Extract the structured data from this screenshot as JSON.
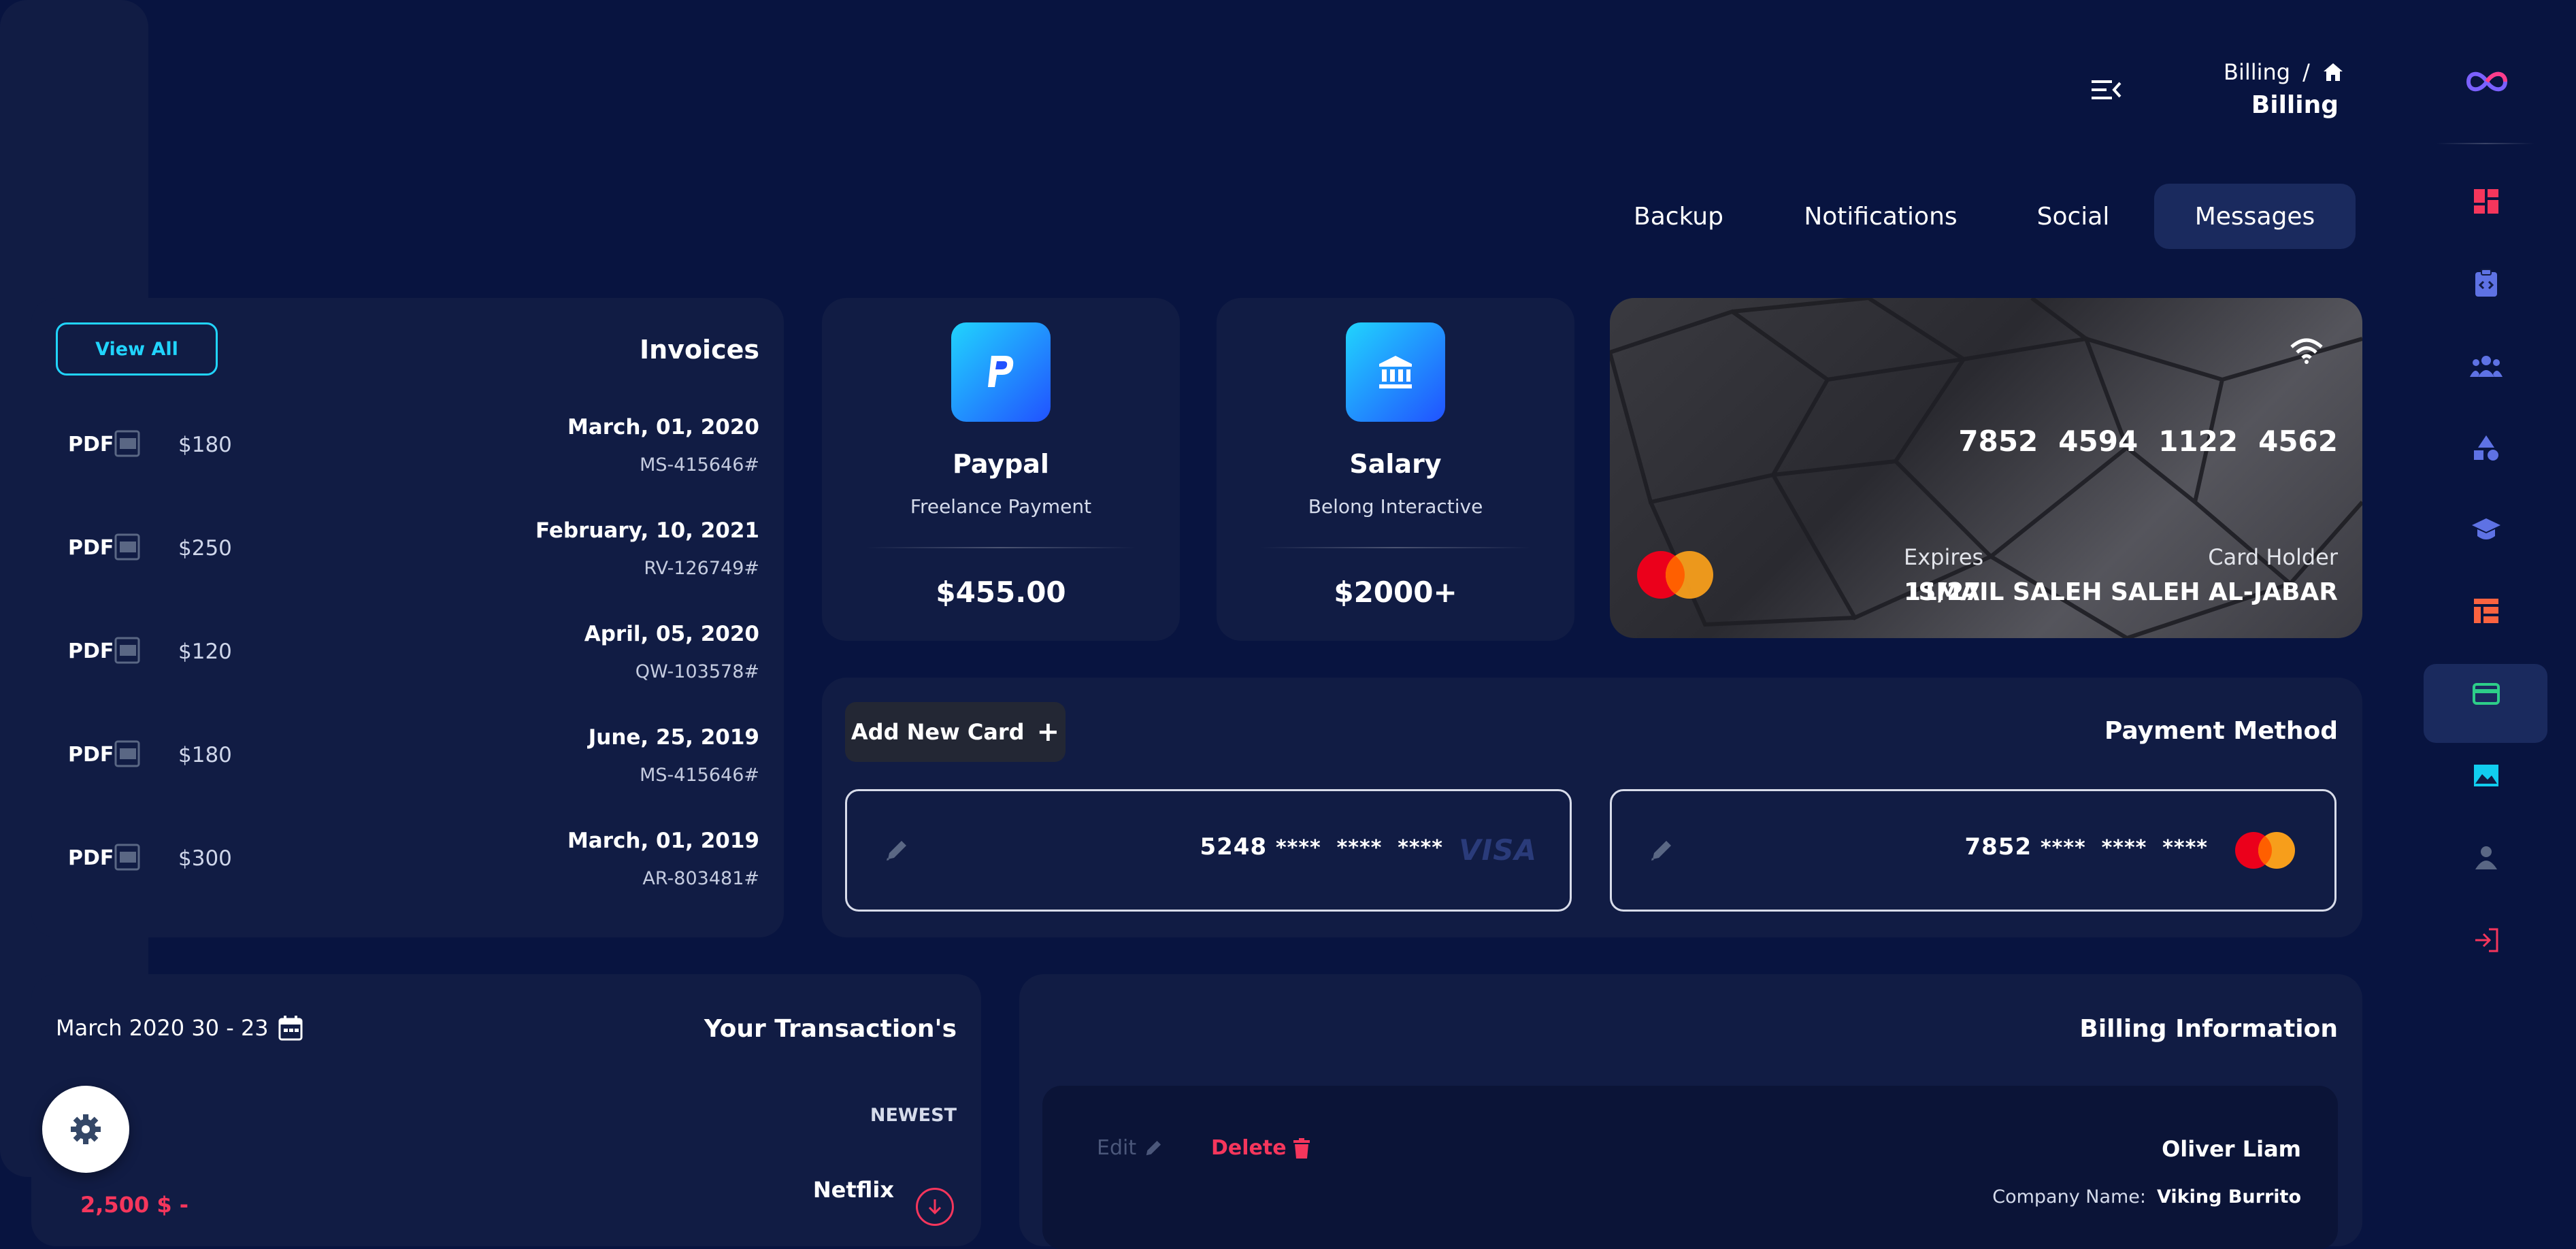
{
  "header": {
    "breadcrumb_current": "Billing",
    "breadcrumb_separator": "/",
    "page_title": "Billing"
  },
  "tabs": [
    {
      "label": "Backup"
    },
    {
      "label": "Notifications"
    },
    {
      "label": "Social"
    },
    {
      "label": "Messages",
      "active": true
    }
  ],
  "invoices": {
    "title": "Invoices",
    "view_all_label": "View All",
    "items": [
      {
        "pdf": "PDF",
        "amount": "$180",
        "date": "March, 01, 2020",
        "code": "MS-415646#"
      },
      {
        "pdf": "PDF",
        "amount": "$250",
        "date": "February, 10, 2021",
        "code": "RV-126749#"
      },
      {
        "pdf": "PDF",
        "amount": "$120",
        "date": "April, 05, 2020",
        "code": "QW-103578#"
      },
      {
        "pdf": "PDF",
        "amount": "$180",
        "date": "June, 25, 2019",
        "code": "MS-415646#"
      },
      {
        "pdf": "PDF",
        "amount": "$300",
        "date": "March, 01, 2019",
        "code": "AR-803481#"
      }
    ]
  },
  "paypal": {
    "title": "Paypal",
    "subtitle": "Freelance Payment",
    "value": "$455.00",
    "icon": "paypal-icon"
  },
  "salary": {
    "title": "Salary",
    "subtitle": "Belong Interactive",
    "value": "$2000+",
    "icon": "bank-icon"
  },
  "credit_card": {
    "number_groups": [
      "7852",
      "4594",
      "1122",
      "4562"
    ],
    "expires_label": "Expires",
    "expires_value": "11/27",
    "holder_label": "Card Holder",
    "holder_value": "ISMAIL SALEH SALEH AL-JABAR"
  },
  "payment_method": {
    "title": "Payment Method",
    "add_card_label": "Add New Card",
    "add_card_icon": "+",
    "cards": [
      {
        "first": "5248",
        "masked": "****  ****  ****",
        "brand": "VISA"
      },
      {
        "first": "7852",
        "masked": "****  ****  ****",
        "brand": "mastercard"
      }
    ]
  },
  "transactions": {
    "title": "Your Transaction's",
    "date_range": "March 2020 30 - 23",
    "sort_label": "NEWEST",
    "items": [
      {
        "name": "Netflix",
        "amount": "2,500 $ -"
      }
    ]
  },
  "billing_info": {
    "title": "Billing Information",
    "edit_label": "Edit",
    "delete_label": "Delete",
    "name": "Oliver Liam",
    "company_label": "Company Name:",
    "company_value": "Viking Burrito"
  },
  "colors": {
    "background": "#081440",
    "panel": "#111c44",
    "accent_blue": "#21d4fd",
    "delete_red": "#ea0606",
    "sidebar_active": "#1a2a5e"
  }
}
